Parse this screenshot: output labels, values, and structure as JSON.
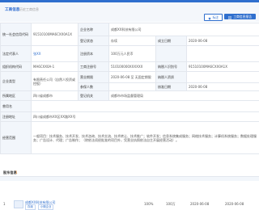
{
  "header": {
    "title": "工商信息",
    "subtitle": "历史工商信息",
    "btn_mark": "标注",
    "btn_report": "工商信息报告"
  },
  "rows": [
    {
      "label": "统一社会信用代码",
      "value": "91510100MA6CXX0A1X",
      "label2": "企业名称",
      "value2": "成都XX科技有限公司",
      "label3": "",
      "value3": ""
    },
    {
      "label": "",
      "value": "",
      "label2": "登记状态",
      "value2": "存续",
      "label3": "成立日期",
      "value3": "2020-06-08"
    },
    {
      "label": "法定代表人",
      "value": "张XX",
      "label2": "注册资本",
      "value2": "100万元人民币",
      "label3": "",
      "value3": ""
    },
    {
      "label": "组织机构代码",
      "value": "MA6CXX0A-1",
      "label2": "工商注册号",
      "value2": "510100000XXXXXX",
      "label3": "纳税人识别号",
      "value3": "91510100MA6CXX0A1X"
    },
    {
      "label": "企业类型",
      "value": "有限责任公司（自然人投资或控股）",
      "label2": "营业期限",
      "value2": "2020-06-08 至 无固定期限",
      "label3": "纳税人资质",
      "value3": ""
    },
    {
      "label": "",
      "value": "",
      "label2": "参保人数",
      "value2": "",
      "label3": "核准日期",
      "value3": "2020-06-08"
    },
    {
      "label": "所属地区",
      "value": "四川省成都市",
      "label2": "登记机关",
      "value2": "成都市市场监督管理局",
      "label3": "",
      "value3": ""
    },
    {
      "label": "曾用名",
      "value": "",
      "label2": "",
      "value2": "",
      "label3": "",
      "value3": ""
    },
    {
      "label": "注册地址",
      "value": "四川省成都市XX区XX路XX号",
      "label2": "",
      "value2": "",
      "label3": "",
      "value3": ""
    },
    {
      "label": "经营范围",
      "value": "一般项目：技术服务、技术开发、技术咨询、技术交流、技术转让、技术推广；软件开发；信息系统集成服务；网络技术服务；计算机系统服务；数据处理服务；广告设计、代理；广告制作；（除依法须经批准的项目外，凭营业执照依法自主开展经营活动）。",
      "label2": "",
      "value2": "",
      "label3": "",
      "value3": ""
    }
  ],
  "bottom": {
    "title": "股东信息",
    "count": "1",
    "rank": "1",
    "company_name": "成都XX科技有限公司",
    "company_tag1": "存续",
    "company_tag2": "小微企业",
    "percent": "100%",
    "amount": "100万",
    "date": "2020-06-08",
    "date2": "2020-06-08"
  }
}
